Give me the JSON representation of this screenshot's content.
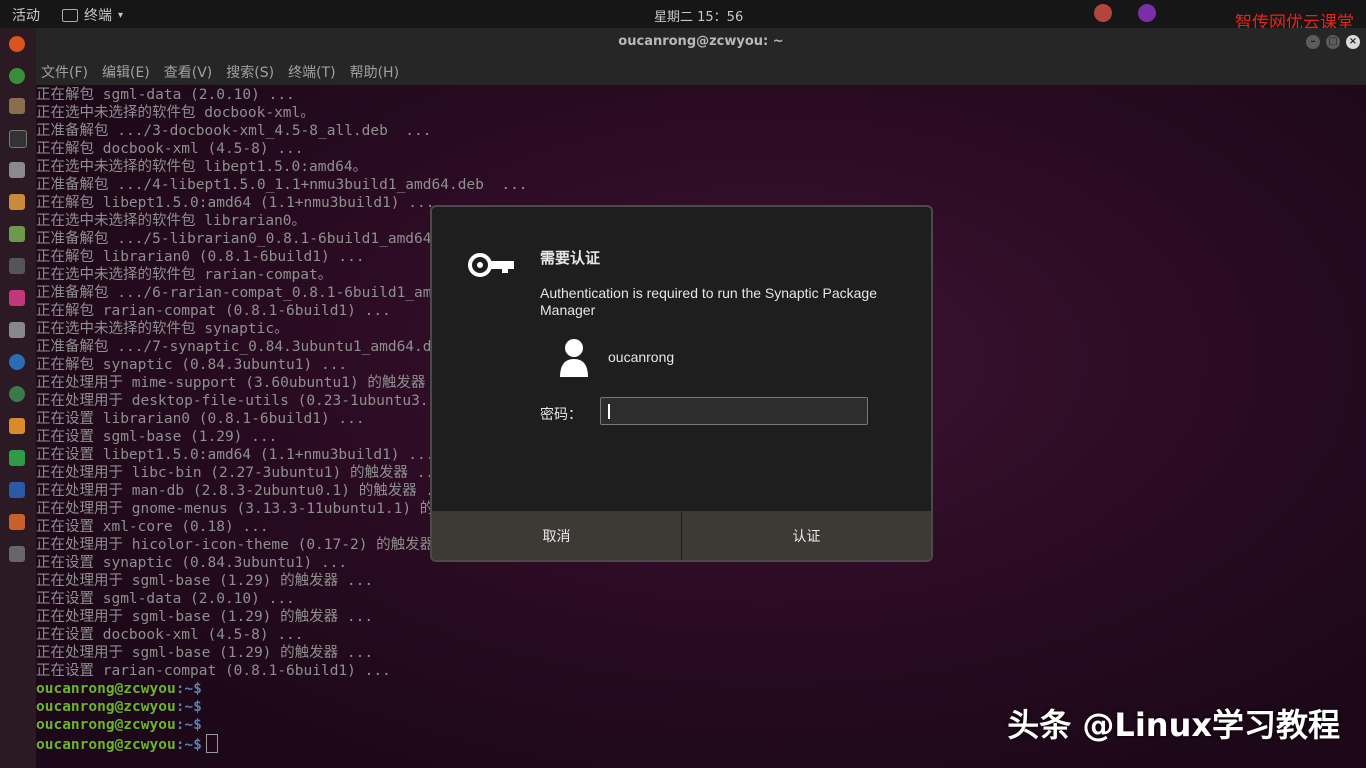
{
  "topbar": {
    "activities": "活动",
    "app_name": "终端",
    "clock": "星期二 15：56"
  },
  "watermark_top": "智传网优云课堂",
  "watermark_bottom": "头条 @Linux学习教程",
  "window": {
    "title": "oucanrong@zcwyou: ~",
    "menu": [
      "文件(F)",
      "编辑(E)",
      "查看(V)",
      "搜索(S)",
      "终端(T)",
      "帮助(H)"
    ]
  },
  "terminal": {
    "lines": [
      "正在解包 sgml-data (2.0.10) ...",
      "正在选中未选择的软件包 docbook-xml。",
      "正准备解包 .../3-docbook-xml_4.5-8_all.deb  ...",
      "正在解包 docbook-xml (4.5-8) ...",
      "正在选中未选择的软件包 libept1.5.0:amd64。",
      "正准备解包 .../4-libept1.5.0_1.1+nmu3build1_amd64.deb  ...",
      "正在解包 libept1.5.0:amd64 (1.1+nmu3build1) ...",
      "正在选中未选择的软件包 librarian0。",
      "正准备解包 .../5-librarian0_0.8.1-6build1_amd64.deb  ...",
      "正在解包 librarian0 (0.8.1-6build1) ...",
      "正在选中未选择的软件包 rarian-compat。",
      "正准备解包 .../6-rarian-compat_0.8.1-6build1_amd64.deb  ...",
      "正在解包 rarian-compat (0.8.1-6build1) ...",
      "正在选中未选择的软件包 synaptic。",
      "正准备解包 .../7-synaptic_0.84.3ubuntu1_amd64.deb  ...",
      "正在解包 synaptic (0.84.3ubuntu1) ...",
      "正在处理用于 mime-support (3.60ubuntu1) 的触发器 ...",
      "正在处理用于 desktop-file-utils (0.23-1ubuntu3.18.04.2) 的触发器 ...",
      "正在设置 librarian0 (0.8.1-6build1) ...",
      "正在设置 sgml-base (1.29) ...",
      "正在设置 libept1.5.0:amd64 (1.1+nmu3build1) ...",
      "正在处理用于 libc-bin (2.27-3ubuntu1) 的触发器 ...",
      "正在处理用于 man-db (2.8.3-2ubuntu0.1) 的触发器 ...",
      "正在处理用于 gnome-menus (3.13.3-11ubuntu1.1) 的触发器 ...",
      "正在设置 xml-core (0.18) ...",
      "正在处理用于 hicolor-icon-theme (0.17-2) 的触发器 ...",
      "正在设置 synaptic (0.84.3ubuntu1) ...",
      "正在处理用于 sgml-base (1.29) 的触发器 ...",
      "正在设置 sgml-data (2.0.10) ...",
      "正在处理用于 sgml-base (1.29) 的触发器 ...",
      "正在设置 docbook-xml (4.5-8) ...",
      "正在处理用于 sgml-base (1.29) 的触发器 ...",
      "正在设置 rarian-compat (0.8.1-6build1) ..."
    ],
    "prompt_user": "oucanrong@zcwyou",
    "prompt_path": ":~$",
    "prompt_count": 4
  },
  "dialog": {
    "title": "需要认证",
    "message": "Authentication is required to run the Synaptic Package Manager",
    "username": "oucanrong",
    "password_label": "密码：",
    "password_value": "",
    "cancel_label": "取消",
    "auth_label": "认证"
  }
}
